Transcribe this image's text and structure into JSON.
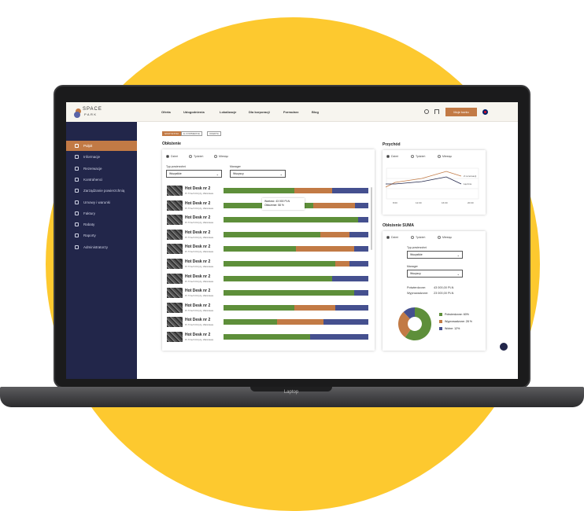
{
  "colors": {
    "background_circle": "#fdc92f",
    "accent": "#c27a45",
    "sidebar": "#22264a",
    "green": "#5e8f3a",
    "orange": "#c27a45",
    "blue": "#45508f"
  },
  "laptop_label": "Laptop",
  "logo": {
    "line1": "SPACE",
    "line2": "PARK"
  },
  "nav": [
    "Oferta",
    "Udogodnienia",
    "Lokalizacje",
    "Dla korporacji",
    "Formularz",
    "Blog"
  ],
  "header": {
    "account_button": "Moje konto",
    "icons": [
      "location-icon",
      "house-icon",
      "uk-flag-icon"
    ]
  },
  "sidebar": [
    "Pulpit",
    "Informacje",
    "Rezerwacje",
    "Kontrahenci",
    "Zarządzanie powierzchnią",
    "Umowy i warunki",
    "Faktury",
    "Rabaty",
    "Raporty",
    "Administratorzy"
  ],
  "tabs": [
    "STATYSTYKI",
    "E-COMMERCE",
    "OFERTA"
  ],
  "occupancy": {
    "title": "Obłożenie",
    "radios": [
      "Dzień",
      "Tydzień",
      "Miesiąc"
    ],
    "type_label": "Typ powierzchni",
    "type_value": "Wszystkie",
    "manager_label": "Manager",
    "manager_value": "Wszyscy",
    "tooltip": {
      "line1": "Wartość: 43 000 PLN",
      "line2": "Obłożenie: 58 %"
    },
    "rows": [
      {
        "title": "Hot Desk nr 2",
        "sub": "Pl. Trzech Krzyży, Warszawa",
        "segments": [
          0.49,
          0.26,
          0.25
        ]
      },
      {
        "title": "Hot Desk nr 2",
        "sub": "Pl. Trzech Krzyży, Warszawa",
        "segments": [
          0.62,
          0.29,
          0.09
        ]
      },
      {
        "title": "Hot Desk nr 2",
        "sub": "Pl. Trzech Krzyży, Warszawa",
        "segments": [
          0.93,
          0,
          0.07
        ]
      },
      {
        "title": "Hot Desk nr 2",
        "sub": "Pl. Trzech Krzyży, Warszawa",
        "segments": [
          0.67,
          0.2,
          0.13
        ]
      },
      {
        "title": "Hot Desk nr 2",
        "sub": "Pl. Trzech Krzyży, Warszawa",
        "segments": [
          0.5,
          0.4,
          0.1
        ]
      },
      {
        "title": "Hot Desk nr 2",
        "sub": "Pl. Trzech Krzyży, Warszawa",
        "segments": [
          0.77,
          0.1,
          0.13
        ]
      },
      {
        "title": "Hot Desk nr 2",
        "sub": "Pl. Trzech Krzyży, Warszawa",
        "segments": [
          0.75,
          0,
          0.25
        ]
      },
      {
        "title": "Hot Desk nr 2",
        "sub": "Pl. Trzech Krzyży, Warszawa",
        "segments": [
          0.9,
          0,
          0.1
        ]
      },
      {
        "title": "Hot Desk nr 2",
        "sub": "Pl. Trzech Krzyży, Warszawa",
        "segments": [
          0.49,
          0.28,
          0.23
        ]
      },
      {
        "title": "Hot Desk nr 2",
        "sub": "Pl. Trzech Krzyży, Warszawa",
        "segments": [
          0.37,
          0.32,
          0.31
        ]
      },
      {
        "title": "Hot Desk nr 2",
        "sub": "Pl. Trzech Krzyży, Warszawa",
        "segments": [
          0.6,
          0,
          0.4
        ]
      }
    ]
  },
  "revenue": {
    "title": "Przychód",
    "radios": [
      "Dzień",
      "Tydzień",
      "Miesiąc"
    ],
    "x_labels": [
      "8:00",
      "12:00",
      "16:00",
      "20:00"
    ],
    "series": [
      {
        "name": "Z rezerwacji",
        "color": "#c27a45"
      },
      {
        "name": "Łącznie",
        "color": "#22264a"
      }
    ]
  },
  "sum": {
    "title": "Obłożenie SUMA",
    "radios": [
      "Dzień",
      "Tydzień",
      "Miesiąc"
    ],
    "type_label": "Typ powierzchni",
    "type_value": "Wszystkie",
    "manager_label": "Manager",
    "manager_value": "Wszyscy",
    "confirmed_label": "Potwierdzone:",
    "confirmed_value": "43 000,00 PLN",
    "rented_label": "Wyprowadzone:",
    "rented_value": "23 000,00 PLN",
    "legend": [
      {
        "label": "Potwierdzone: 60%",
        "value": 60,
        "color": "#5e8f3a"
      },
      {
        "label": "Wyprowadzone: 28 %",
        "value": 28,
        "color": "#c27a45"
      },
      {
        "label": "Wolne: 12%",
        "value": 12,
        "color": "#45508f"
      }
    ]
  }
}
